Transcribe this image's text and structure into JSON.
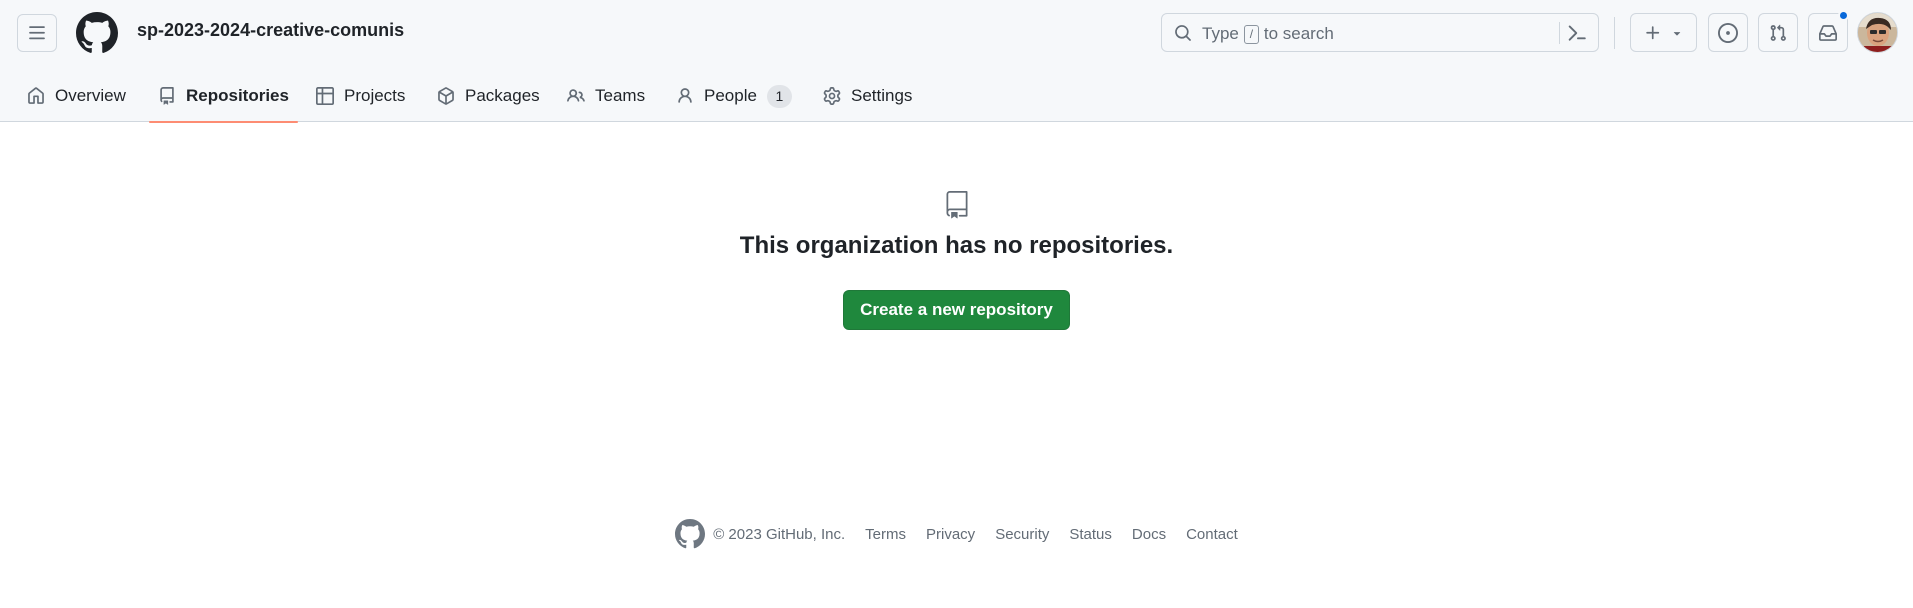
{
  "header": {
    "org_name": "sp-2023-2024-creative-comunis",
    "search": {
      "placeholder_before": "Type",
      "placeholder_key": "/",
      "placeholder_after": "to search"
    },
    "notification_dot_color": "#0969da"
  },
  "tabs": [
    {
      "label": "Overview",
      "icon": "home-icon",
      "active": false
    },
    {
      "label": "Repositories",
      "icon": "repo-icon",
      "active": true
    },
    {
      "label": "Projects",
      "icon": "table-icon",
      "active": false
    },
    {
      "label": "Packages",
      "icon": "package-icon",
      "active": false
    },
    {
      "label": "Teams",
      "icon": "people-icon",
      "active": false
    },
    {
      "label": "People",
      "icon": "person-icon",
      "active": false,
      "count": "1"
    },
    {
      "label": "Settings",
      "icon": "gear-icon",
      "active": false
    }
  ],
  "main": {
    "empty_message": "This organization has no repositories.",
    "create_button": "Create a new repository",
    "primary_color": "#1f883d"
  },
  "footer": {
    "copyright": "© 2023 GitHub, Inc.",
    "links": [
      "Terms",
      "Privacy",
      "Security",
      "Status",
      "Docs",
      "Contact"
    ]
  },
  "colors": {
    "active_tab_underline": "#fd8c73",
    "header_bg": "#f6f8fa"
  }
}
